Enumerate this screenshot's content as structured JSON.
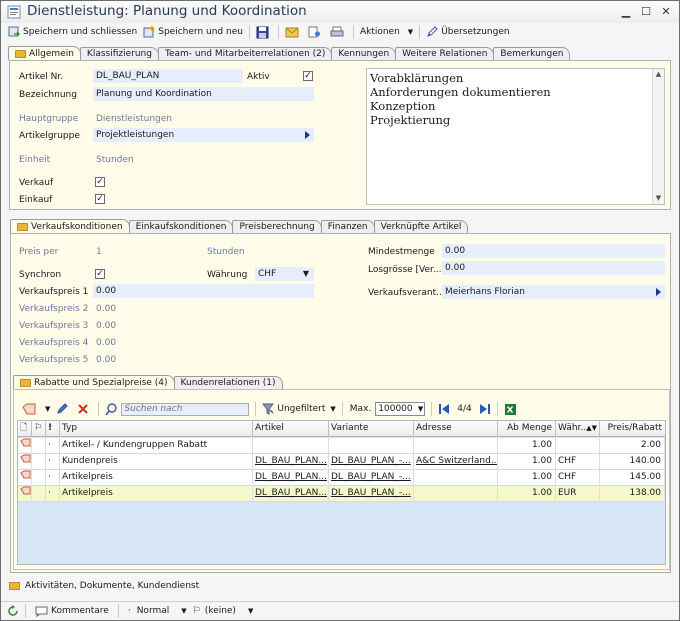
{
  "window": {
    "title": "Dienstleistung: Planung und Koordination"
  },
  "toolbar": {
    "save_close": "Speichern und schliessen",
    "save_new": "Speichern und neu",
    "actions": "Aktionen",
    "translations": "Übersetzungen"
  },
  "top_tabs": [
    "Allgemein",
    "Klassifizierung",
    "Team- und Mitarbeiterrelationen (2)",
    "Kennungen",
    "Weitere Relationen",
    "Bemerkungen"
  ],
  "general": {
    "artikel_nr_label": "Artikel Nr.",
    "artikel_nr": "DL_BAU_PLAN",
    "aktiv_label": "Aktiv",
    "bezeichnung_label": "Bezeichnung",
    "bezeichnung": "Planung und Koordination",
    "hauptgruppe_label": "Hauptgruppe",
    "hauptgruppe": "Dienstleistungen",
    "artikelgruppe_label": "Artikelgruppe",
    "artikelgruppe": "Projektleistungen",
    "einheit_label": "Einheit",
    "einheit": "Stunden",
    "verkauf_label": "Verkauf",
    "einkauf_label": "Einkauf",
    "memo": [
      "Vorabklärungen",
      "Anforderungen dokumentieren",
      "Konzeption",
      "Projektierung"
    ]
  },
  "mid_tabs": [
    "Verkaufskonditionen",
    "Einkaufskonditionen",
    "Preisberechnung",
    "Finanzen",
    "Verknüpfte Artikel"
  ],
  "sales": {
    "preis_per_label": "Preis per",
    "preis_per": "1",
    "preis_per_unit": "Stunden",
    "synchron_label": "Synchron",
    "waehrung_label": "Währung",
    "waehrung": "CHF",
    "vp1_label": "Verkaufspreis 1",
    "vp1": "0.00",
    "vp2_label": "Verkaufspreis 2",
    "vp2": "0.00",
    "vp3_label": "Verkaufspreis 3",
    "vp3": "0.00",
    "vp4_label": "Verkaufspreis 4",
    "vp4": "0.00",
    "vp5_label": "Verkaufspreis 5",
    "vp5": "0.00",
    "mindestmenge_label": "Mindestmenge",
    "mindestmenge": "0.00",
    "losgroesse_label": "Losgrösse [Ver...",
    "losgroesse": "0.00",
    "verantwortlich_label": "Verkaufsverant...",
    "verantwortlich": "Meierhans Florian"
  },
  "sub_tabs": [
    "Rabatte und Spezialpreise (4)",
    "Kundenrelationen (1)"
  ],
  "grid_toolbar": {
    "search_placeholder": "Suchen nach",
    "filter": "Ungefiltert",
    "max_label": "Max.",
    "max_value": "100000",
    "page": "4/4"
  },
  "grid": {
    "headers": [
      "Typ",
      "Artikel",
      "Variante",
      "Adresse",
      "Ab Menge",
      "Währ...",
      "Preis/Rabatt"
    ],
    "rows": [
      {
        "typ": "Artikel- / Kundengruppen Rabatt",
        "artikel": "",
        "variante": "",
        "adresse": "",
        "menge": "1.00",
        "waehrung": "",
        "preis": "2.00"
      },
      {
        "typ": "Kundenpreis",
        "artikel": "DL_BAU_PLAN...",
        "variante": "DL_BAU_PLAN_-...",
        "adresse": "A&C Switzerland...",
        "menge": "1.00",
        "waehrung": "CHF",
        "preis": "140.00"
      },
      {
        "typ": "Artikelpreis",
        "artikel": "DL_BAU_PLAN...",
        "variante": "DL_BAU_PLAN_-...",
        "adresse": "",
        "menge": "1.00",
        "waehrung": "CHF",
        "preis": "145.00"
      },
      {
        "typ": "Artikelpreis",
        "artikel": "DL_BAU_PLAN...",
        "variante": "DL_BAU_PLAN_-...",
        "adresse": "",
        "menge": "1.00",
        "waehrung": "EUR",
        "preis": "138.00"
      }
    ]
  },
  "bottom_group": "Aktivitäten, Dokumente, Kundendienst",
  "status": {
    "comments": "Kommentare",
    "priority": "Normal",
    "flag": "(keine)"
  }
}
